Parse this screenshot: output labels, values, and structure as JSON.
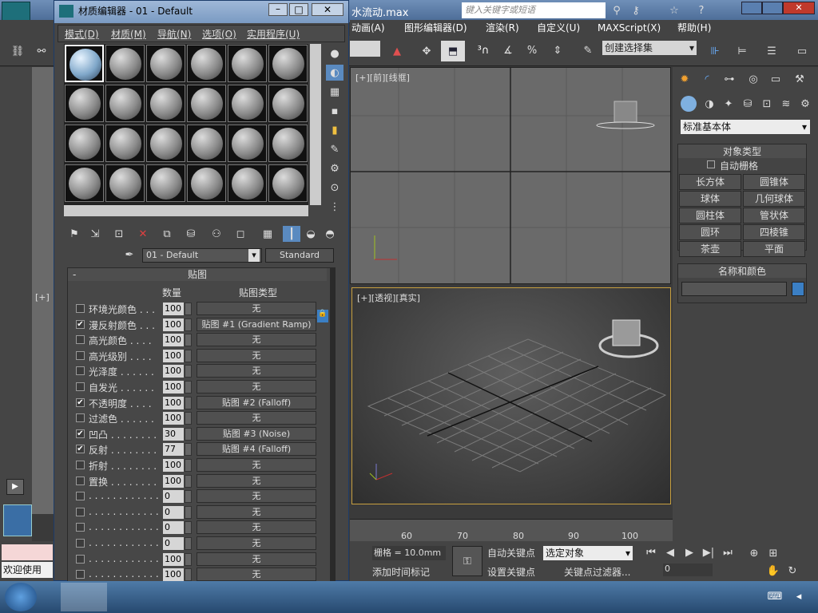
{
  "app": {
    "window_title_suffix": "水流动.max",
    "search_placeholder": "键入关键字或短语",
    "menus": [
      "动画(A)",
      "图形编辑器(D)",
      "渲染(R)",
      "自定义(U)",
      "MAXScript(X)",
      "帮助(H)"
    ],
    "selection_set": "创建选择集"
  },
  "viewports": {
    "front_label": "[+][前][线框]",
    "perspective_label": "[+][透视][真实]",
    "top_left_label": "[+]",
    "left_label": "[+]",
    "timeline_ticks": [
      "60",
      "70",
      "80",
      "90",
      "100"
    ]
  },
  "command_panel": {
    "dropdown": "标准基本体",
    "object_type_title": "对象类型",
    "auto_grid": "自动栅格",
    "buttons": [
      "长方体",
      "圆锥体",
      "球体",
      "几何球体",
      "圆柱体",
      "管状体",
      "圆环",
      "四棱锥",
      "茶壶",
      "平面"
    ],
    "name_color_title": "名称和颜色"
  },
  "status": {
    "grid": "栅格 = 10.0mm",
    "auto_key": "自动关键点",
    "set_key": "设置关键点",
    "selected": "选定对象",
    "key_filter": "关键点过滤器...",
    "add_time_tag": "添加时间标记",
    "welcome": "欢迎使用",
    "frame": "0"
  },
  "material_editor": {
    "title": "材质编辑器 - 01 - Default",
    "menu": [
      "模式(D)",
      "材质(M)",
      "导航(N)",
      "选项(O)",
      "实用程序(U)"
    ],
    "material_name": "01 - Default",
    "material_type": "Standard",
    "rollout_title": "贴图",
    "col_amount": "数量",
    "col_maptype": "贴图类型",
    "maps": [
      {
        "label": "环境光颜色 . . .",
        "checked": false,
        "amount": "100",
        "map": "无"
      },
      {
        "label": "漫反射颜色 . . .",
        "checked": true,
        "amount": "100",
        "map": "贴图 #1 (Gradient Ramp)"
      },
      {
        "label": "高光颜色 . . . .",
        "checked": false,
        "amount": "100",
        "map": "无"
      },
      {
        "label": "高光级别 . . . .",
        "checked": false,
        "amount": "100",
        "map": "无"
      },
      {
        "label": "光泽度 . . . . . .",
        "checked": false,
        "amount": "100",
        "map": "无"
      },
      {
        "label": "自发光 . . . . . .",
        "checked": false,
        "amount": "100",
        "map": "无"
      },
      {
        "label": "不透明度 . . . .",
        "checked": true,
        "amount": "100",
        "map": "贴图 #2 (Falloff)"
      },
      {
        "label": "过滤色 . . . . . .",
        "checked": false,
        "amount": "100",
        "map": "无"
      },
      {
        "label": "凹凸 . . . . . . . .",
        "checked": true,
        "amount": "30",
        "map": "贴图 #3 (Noise)"
      },
      {
        "label": "反射 . . . . . . . .",
        "checked": true,
        "amount": "77",
        "map": "贴图 #4 (Falloff)"
      },
      {
        "label": "折射 . . . . . . . .",
        "checked": false,
        "amount": "100",
        "map": "无"
      },
      {
        "label": "置换 . . . . . . . .",
        "checked": false,
        "amount": "100",
        "map": "无"
      },
      {
        "label": ". . . . . . . . . . . .",
        "checked": false,
        "amount": "0",
        "map": "无"
      },
      {
        "label": ". . . . . . . . . . . .",
        "checked": false,
        "amount": "0",
        "map": "无"
      },
      {
        "label": ". . . . . . . . . . . .",
        "checked": false,
        "amount": "0",
        "map": "无"
      },
      {
        "label": ". . . . . . . . . . . .",
        "checked": false,
        "amount": "0",
        "map": "无"
      },
      {
        "label": ". . . . . . . . . . . .",
        "checked": false,
        "amount": "100",
        "map": "无"
      },
      {
        "label": ". . . . . . . . . . . .",
        "checked": false,
        "amount": "100",
        "map": "无"
      }
    ]
  },
  "colors": {
    "accent": "#3b7fc4",
    "viewport_active": "#c8a040"
  }
}
